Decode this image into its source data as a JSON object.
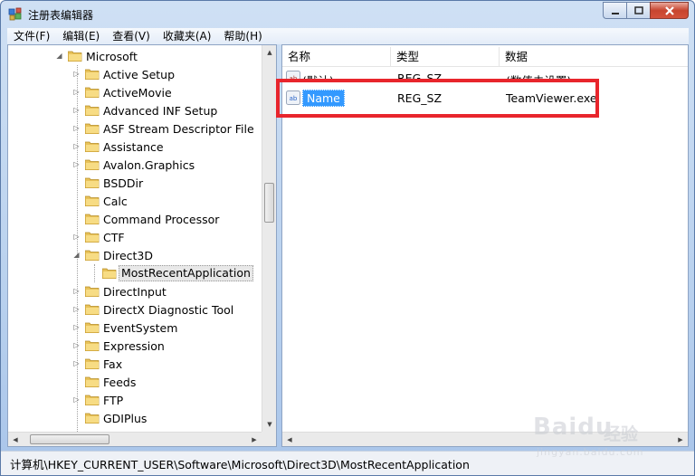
{
  "window": {
    "title": "注册表编辑器"
  },
  "menu": [
    "文件(F)",
    "编辑(E)",
    "查看(V)",
    "收藏夹(A)",
    "帮助(H)"
  ],
  "tree": {
    "parent": "Microsoft",
    "items": [
      "Active Setup",
      "ActiveMovie",
      "Advanced INF Setup",
      "ASF Stream Descriptor File",
      "Assistance",
      "Avalon.Graphics",
      "BSDDir",
      "Calc",
      "Command Processor",
      "CTF",
      "Direct3D",
      "DirectInput",
      "DirectX Diagnostic Tool",
      "EventSystem",
      "Expression",
      "Fax",
      "Feeds",
      "FTP",
      "GDIPlus"
    ],
    "selected_child": "MostRecentApplication"
  },
  "list": {
    "columns": [
      "名称",
      "类型",
      "数据"
    ],
    "rows": [
      {
        "name": "(默认)",
        "type": "REG_SZ",
        "data": "(数值未设置)"
      },
      {
        "name": "Name",
        "type": "REG_SZ",
        "data": "TeamViewer.exe"
      }
    ]
  },
  "status": {
    "path": "计算机\\HKEY_CURRENT_USER\\Software\\Microsoft\\Direct3D\\MostRecentApplication"
  },
  "watermark": {
    "brand": "Baidu",
    "jingyan": "经验",
    "url": "jingyan.baidu.com"
  },
  "colors": {
    "highlight": "#e8252c",
    "selection": "#3399ff",
    "folder": "#e8c25a"
  }
}
